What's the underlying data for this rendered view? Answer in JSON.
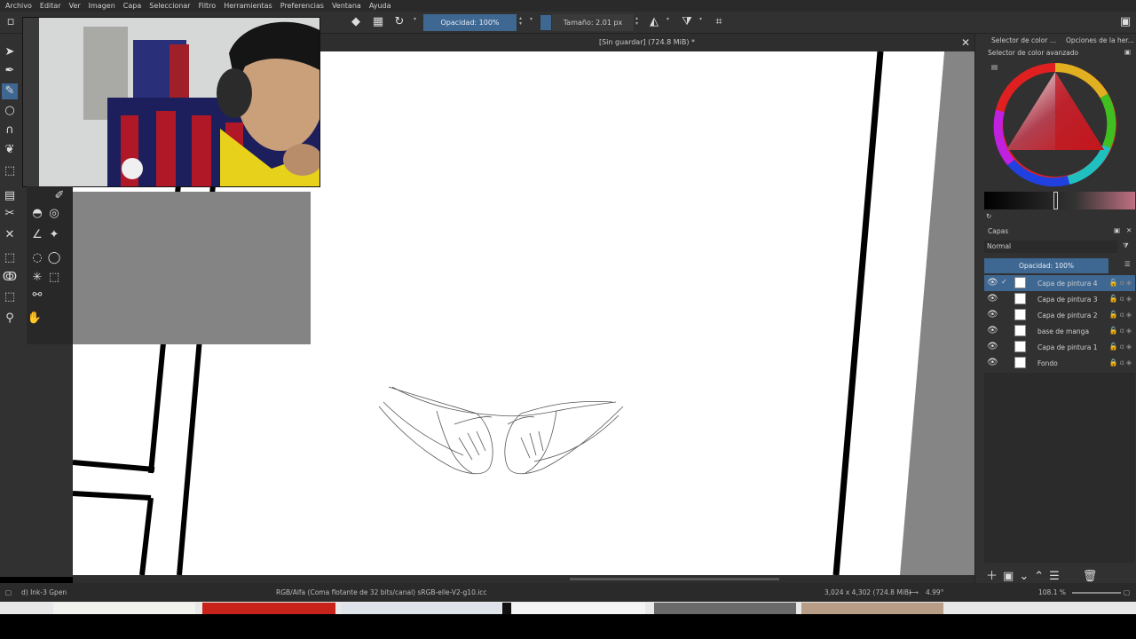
{
  "menu": [
    "Archivo",
    "Editar",
    "Ver",
    "Imagen",
    "Capa",
    "Seleccionar",
    "Filtro",
    "Herramientas",
    "Preferencias",
    "Ventana",
    "Ayuda"
  ],
  "toolbar": {
    "opacity_label": "Opacidad: 100%",
    "size_label": "Tamaño: 2.01 px"
  },
  "document": {
    "title": "[Sin guardar]  (724.8 MiB) *"
  },
  "right_panel": {
    "tab_color": "Selector de color ...",
    "tab_options": "Opciones de la her...",
    "color_header": "Selector de color avanzado",
    "layers_header": "Capas",
    "blend_mode": "Normal",
    "layer_opacity": "Opacidad:  100%",
    "layers": [
      {
        "name": "Capa de pintura 4",
        "active": true
      },
      {
        "name": "Capa de pintura 3",
        "active": false
      },
      {
        "name": "Capa de pintura 2",
        "active": false
      },
      {
        "name": "base de manga",
        "active": false
      },
      {
        "name": "Capa de pintura 1",
        "active": false
      },
      {
        "name": "Fondo",
        "active": false
      }
    ]
  },
  "status": {
    "brush": "d) Ink-3 Gpen",
    "colorspace": "RGB/Alfa (Coma flotante de 32 bits/canal)  sRGB-elle-V2-g10.icc",
    "dimensions": "3,024 x 4,302 (724.8 MiB)",
    "rotation": "4.99°",
    "zoom": "108.1 %"
  },
  "colors": {
    "accent": "#3e6792",
    "panel": "#313131",
    "canvas_bg": "#858585"
  }
}
